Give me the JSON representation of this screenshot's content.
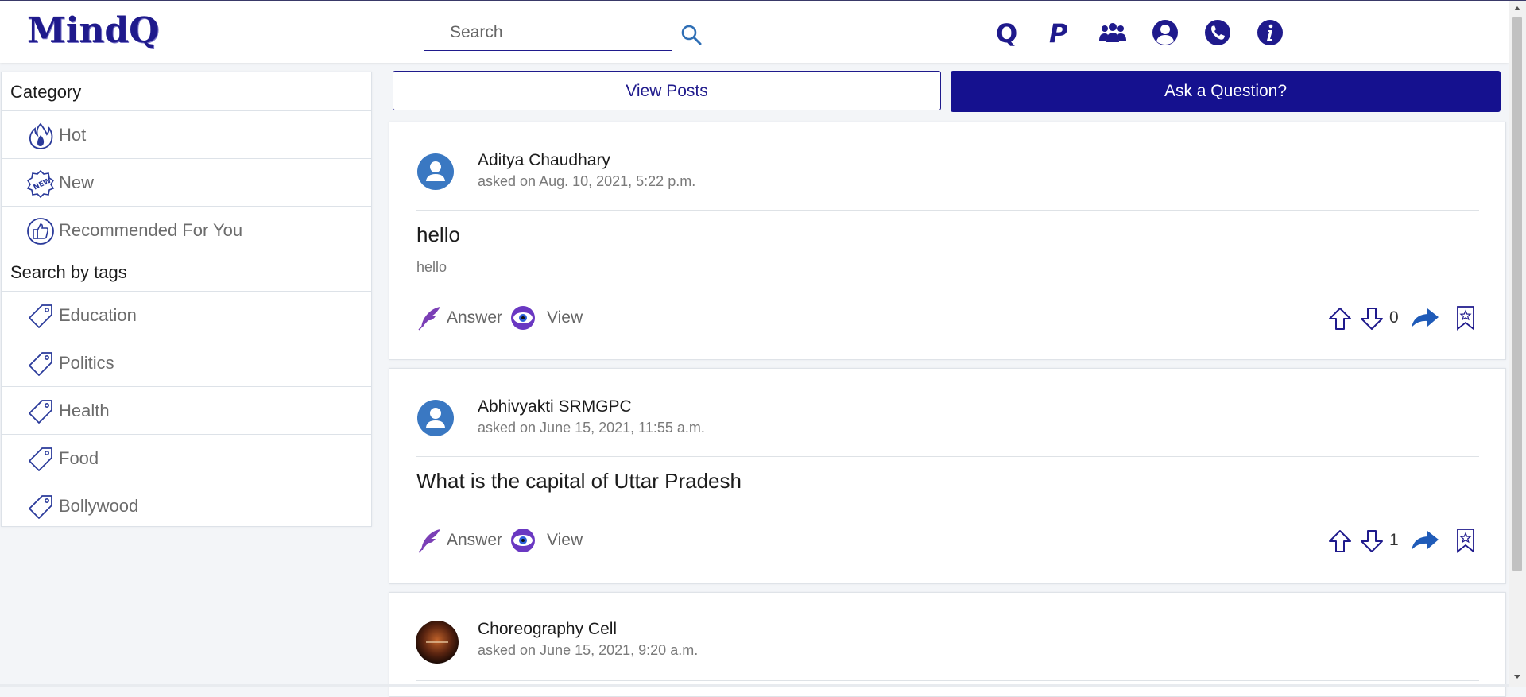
{
  "header": {
    "logo": "MindQ",
    "search_placeholder": "Search",
    "nav_icons": [
      "questions-q-icon",
      "posts-p-icon",
      "groups-icon",
      "profile-icon",
      "contact-phone-icon",
      "info-icon"
    ]
  },
  "sidebar": {
    "category_title": "Category",
    "categories": [
      {
        "label": "Hot",
        "icon": "fire-icon"
      },
      {
        "label": "New",
        "icon": "new-badge-icon"
      },
      {
        "label": "Recommended For You",
        "icon": "thumbs-up-icon"
      }
    ],
    "tags_title": "Search by tags",
    "tags": [
      {
        "label": "Education",
        "icon": "tag-icon"
      },
      {
        "label": "Politics",
        "icon": "tag-icon"
      },
      {
        "label": "Health",
        "icon": "tag-icon"
      },
      {
        "label": "Food",
        "icon": "tag-icon"
      },
      {
        "label": "Bollywood",
        "icon": "tag-icon"
      }
    ]
  },
  "main": {
    "view_posts_label": "View Posts",
    "ask_label": "Ask a Question?",
    "posts": [
      {
        "author": "Aditya Chaudhary",
        "asked": "asked on Aug. 10, 2021, 5:22 p.m.",
        "title": "hello",
        "body": "hello",
        "answer_label": "Answer",
        "view_label": "View",
        "votes": "0"
      },
      {
        "author": "Abhivyakti SRMGPC",
        "asked": "asked on June 15, 2021, 11:55 a.m.",
        "title": "What is the capital of Uttar Pradesh",
        "body": "",
        "answer_label": "Answer",
        "view_label": "View",
        "votes": "1"
      },
      {
        "author": "Choreography Cell",
        "asked": "asked on June 15, 2021, 9:20 a.m."
      }
    ]
  },
  "colors": {
    "brand": "#1f1a8c",
    "button": "#15118f",
    "accent_blue": "#2f6fb5"
  }
}
